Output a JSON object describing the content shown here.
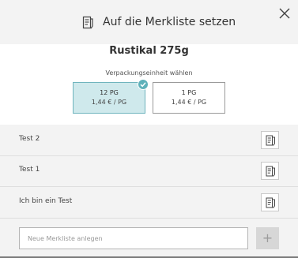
{
  "header": {
    "title": "Auf die Merkliste setzen",
    "icon": "notepad-icon",
    "close_icon": "close-icon"
  },
  "product": {
    "name": "Rustikal 275g"
  },
  "packaging": {
    "label": "Verpackungseinheit wählen",
    "options": [
      {
        "units": "12 PG",
        "price": "1,44 € / PG",
        "selected": true
      },
      {
        "units": "1 PG",
        "price": "1,44 € / PG",
        "selected": false
      }
    ]
  },
  "lists": {
    "items": [
      {
        "label": "Test 2",
        "icon": "add-to-list-icon"
      },
      {
        "label": "Test 1",
        "icon": "add-to-list-icon"
      },
      {
        "label": "Ich bin ein Test",
        "icon": "add-to-list-icon"
      }
    ]
  },
  "footer": {
    "placeholder": "Neue Merkliste anlegen",
    "plus_label": "+"
  },
  "colors": {
    "selected_bg": "#cfe9ec",
    "accent": "#5fb1ba",
    "panel_bg": "#f3f3f3"
  }
}
